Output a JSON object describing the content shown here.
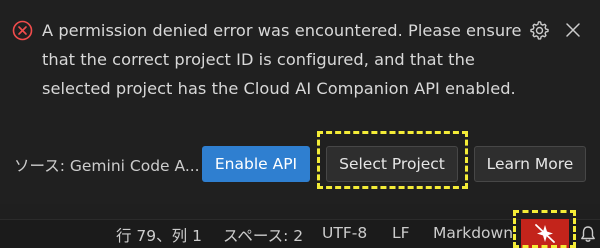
{
  "notification": {
    "message": "A permission denied error was encountered. Please ensure that the correct project ID is configured, and that the selected project has the Cloud AI Companion API enabled.",
    "source": "ソース: Gemini Code A...",
    "actions": {
      "enable_api": "Enable API",
      "select_project": "Select Project",
      "learn_more": "Learn More"
    },
    "icons": [
      "error-icon",
      "gear-icon",
      "close-icon"
    ]
  },
  "statusbar": {
    "position": "行 79、列 1",
    "spaces": "スペース: 2",
    "encoding": "UTF-8",
    "eol": "LF",
    "language": "Markdown",
    "icons": [
      "sparkle-off-icon",
      "bell-icon"
    ]
  },
  "colors": {
    "primary_button": "#2f7fd0",
    "error": "#f14c4c",
    "alert_background": "#c3241b",
    "highlight": "#f4ec37"
  }
}
